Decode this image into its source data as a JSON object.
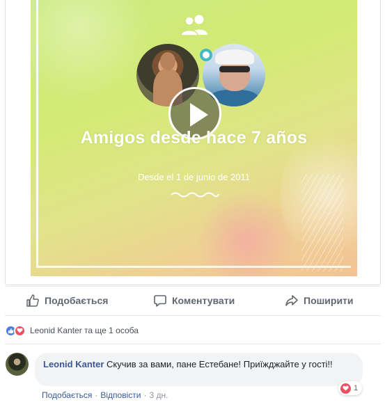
{
  "video": {
    "title": "Amigos desde hace 7 años",
    "subtitle": "Desde el 1 de junio de 2011"
  },
  "actions": {
    "like_label": "Подобається",
    "comment_label": "Коментувати",
    "share_label": "Поширити"
  },
  "reactions": {
    "summary": "Leonid Kanter та ще 1 особа"
  },
  "comment": {
    "author": "Leonid Kanter",
    "text": "Скучив за вами, пане Естебане! Приїжджайте у гості!!",
    "reaction_count": "1",
    "like_link": "Подобається",
    "reply_link": "Відповісти",
    "separator": "·",
    "time": "3 дн."
  },
  "colors": {
    "link": "#385898",
    "like_blue": "#4d7ce9",
    "love_red": "#ef4f63",
    "muted": "#606770"
  },
  "icons": [
    "friends-icon",
    "play-icon",
    "thumbs-up-icon",
    "comment-icon",
    "share-icon",
    "like-reaction-icon",
    "love-reaction-icon"
  ]
}
